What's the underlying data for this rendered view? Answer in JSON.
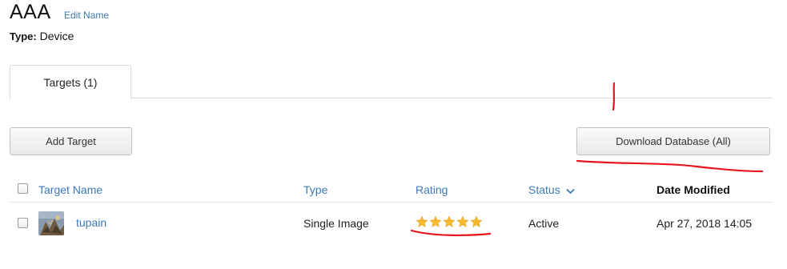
{
  "header": {
    "title": "AAA",
    "edit_name_label": "Edit Name",
    "type_key": "Type:",
    "type_value": "Device"
  },
  "tabs": [
    {
      "label": "Targets (1)",
      "selected": true
    }
  ],
  "toolbar": {
    "add_target_label": "Add Target",
    "download_label": "Download Database (All)"
  },
  "table": {
    "columns": {
      "name": "Target Name",
      "type": "Type",
      "rating": "Rating",
      "status": "Status",
      "date": "Date Modified"
    },
    "status_sort_icon": "chevron-down-icon",
    "rows": [
      {
        "name": "tupain",
        "type": "Single Image",
        "rating": 5,
        "rating_max": 5,
        "status": "Active",
        "date_modified": "Apr 27, 2018 14:05"
      }
    ]
  },
  "colors": {
    "link": "#3d7ab8",
    "star": "#f7b92f",
    "annotation": "#e8141b"
  }
}
